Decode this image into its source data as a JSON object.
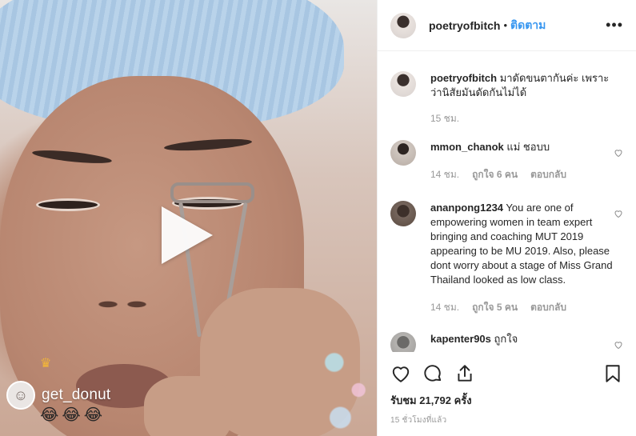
{
  "post": {
    "username": "poetryofbitch",
    "separator": "•",
    "follow_label": "ติดตาม",
    "more_label": "•••",
    "caption_username": "poetryofbitch",
    "caption_text": "มาดัดขนตากันค่ะ เพราะว่านิสัยมันดัดกันไม่ได้",
    "caption_time": "15 ชม."
  },
  "video": {
    "overlay_username": "get_donut",
    "overlay_emojis": "😂😂😂",
    "crown": "♛"
  },
  "comments": [
    {
      "username": "mmon_chanok",
      "text": "แม่ ชอบบ",
      "time": "14 ชม.",
      "likes": "ถูกใจ 6 คน",
      "reply": "ตอบกลับ",
      "avatar_color": "#8a7f78"
    },
    {
      "username": "ananpong1234",
      "text": "You are one of empowering women in team expert bringing and coaching MUT 2019 appearing to be MU 2019. Also, please dont worry about a stage of Miss Grand Thailand looked as low class.",
      "time": "14 ชม.",
      "likes": "ถูกใจ 5 คน",
      "reply": "ตอบกลับ",
      "avatar_color": "#5a4a40"
    },
    {
      "username": "kapenter90s",
      "text": "ถูกใจ",
      "avatar_color": "#9c9a98"
    }
  ],
  "stats": {
    "views": "รับชม 21,792 ครั้ง",
    "posted": "15 ชั่วโมงที่แล้ว"
  },
  "colors": {
    "accent": "#3897f0",
    "muted": "#999999",
    "border": "#efefef"
  }
}
